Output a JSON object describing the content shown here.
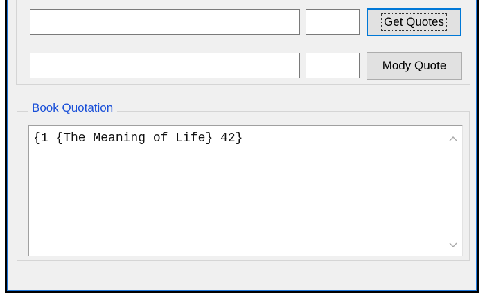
{
  "form": {
    "row1": {
      "text_value": "",
      "number_value": "",
      "button_label": "Get Quotes"
    },
    "row2": {
      "text_value": "",
      "number_value": "",
      "button_label": "Mody Quote"
    }
  },
  "book_quotation": {
    "legend": "Book Quotation",
    "content": "{1 {The Meaning of Life} 42}"
  },
  "scrollbar": {
    "up_icon": "chevron-up-icon",
    "down_icon": "chevron-down-icon"
  },
  "colors": {
    "legend_text": "#1a50d8",
    "window_border": "#1e76d8",
    "focus_border": "#0078d7"
  }
}
